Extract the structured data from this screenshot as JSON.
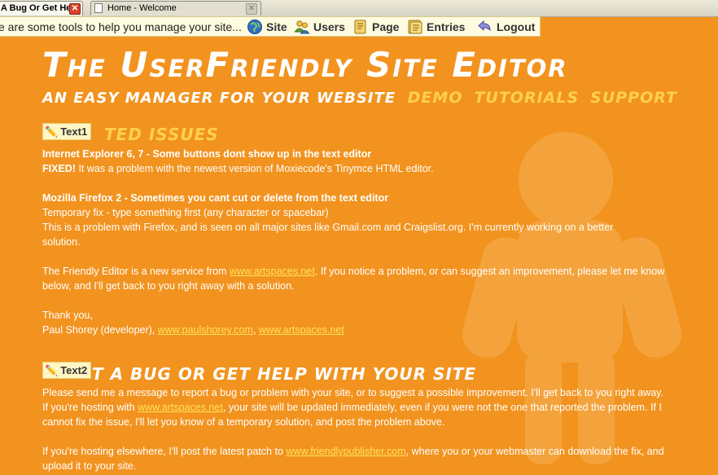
{
  "browser": {
    "tabs": [
      {
        "label": "A Bug Or Get He...",
        "active": true
      },
      {
        "label": "Home - Welcome",
        "active": false
      }
    ]
  },
  "toolbar": {
    "message": "e are some tools to help you manage your site...",
    "buttons": [
      {
        "label": "Site",
        "icon": "globe-icon"
      },
      {
        "label": "Users",
        "icon": "users-icon"
      },
      {
        "label": "Page",
        "icon": "page-icon"
      },
      {
        "label": "Entries",
        "icon": "entries-icon"
      },
      {
        "label": "Logout",
        "icon": "logout-icon"
      }
    ]
  },
  "header": {
    "title": "The UserFriendly Site Editor",
    "subtitle": "AN EASY MANAGER FOR YOUR WEBSITE",
    "nav": [
      "DEMO",
      "TUTORIALS",
      "SUPPORT"
    ]
  },
  "section1": {
    "edit_tag": "Text1",
    "heading": "TED ISSUES",
    "issue1_title": "Internet Explorer 6, 7 - Some buttons dont show up in the text editor",
    "issue1_fixed": "FIXED!",
    "issue1_text": " It was a problem with the newest version of Moxiecode's Tinymce HTML editor.",
    "issue2_title": "Mozilla Firefox 2 - Sometimes you cant cut or delete from the text editor",
    "issue2_line1": "Temporary fix - type something first (any character or spacebar)",
    "issue2_line2": "This is a problem with Firefox, and is seen on all major sites like Gmail.com and Craigslist.org. I'm currently working on a better solution.",
    "intro_pre": "The Friendly Editor is a new service from ",
    "intro_link": "www.artspaces.net",
    "intro_post": ". If you notice a problem, or can suggest an improvement, please let me know below, and I'll get back to you right away with a solution.",
    "thanks": "Thank you,",
    "sign_pre": "Paul Shorey (developer), ",
    "sign_link1": "www.paulshorey.com",
    "sign_sep": ", ",
    "sign_link2": "www.artspaces.net"
  },
  "section2": {
    "edit_tag": "Text2",
    "heading": "T A BUG OR GET HELP WITH YOUR SITE",
    "p1_pre": "Please send me a message to report a bug or problem with your site, or to suggest a possible improvement. I'll get back to you right away. If you're hosting with ",
    "p1_link": "www.artspaces.net",
    "p1_post": ", your site will be updated immediately, even if you were not the one that reported the problem. If I cannot fix the issue, I'll let you know of a temporary solution, and post the problem above.",
    "p2_pre": "If you're hosting elsewhere, I'll post the latest patch to ",
    "p2_link": "www.friendlypublisher.com",
    "p2_post": ", where you or your webmaster can download the fix, and upload it to your site."
  },
  "colors": {
    "background": "#f2931f",
    "accent_yellow": "#ffd14a",
    "link": "#ffe35c",
    "toolbar_bg": "#fffbe0"
  }
}
